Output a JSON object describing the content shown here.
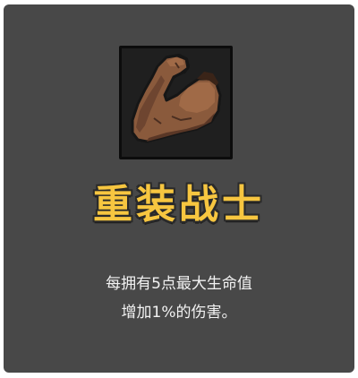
{
  "card": {
    "icon": "flexed-arm-icon",
    "title": "重装战士",
    "description_lines": [
      "每拥有5点最大生命值",
      "增加1%的伤害。"
    ]
  },
  "colors": {
    "card_background": "#484848",
    "title": "#f7c640",
    "text": "#f2f2f2",
    "icon_frame": "#1f1f1f"
  }
}
